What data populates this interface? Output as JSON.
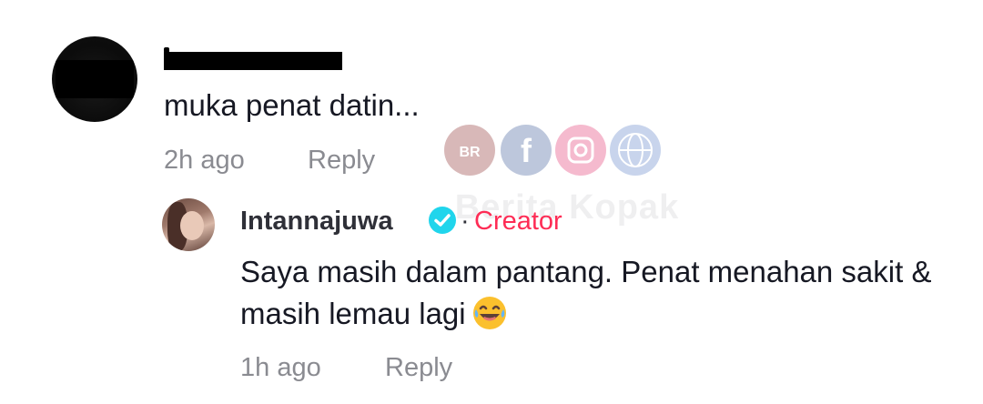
{
  "comment": {
    "username": "",
    "text": "muka penat datin...",
    "time": "2h ago",
    "reply_label": "Reply"
  },
  "reply": {
    "username": "Intannajuwa",
    "creator_badge": "Creator",
    "separator": "·",
    "text": "Saya masih dalam pantang. Penat menahan sakit & masih lemau lagi",
    "time": "1h ago",
    "reply_label": "Reply"
  },
  "watermark": {
    "text": "Berita Kopak",
    "icons": [
      "br-logo-icon",
      "facebook-icon",
      "instagram-icon",
      "globe-icon"
    ]
  },
  "colors": {
    "creator": "#fe2c55",
    "verified": "#20d5ec",
    "meta": "#8a8b91",
    "text": "#161823"
  }
}
